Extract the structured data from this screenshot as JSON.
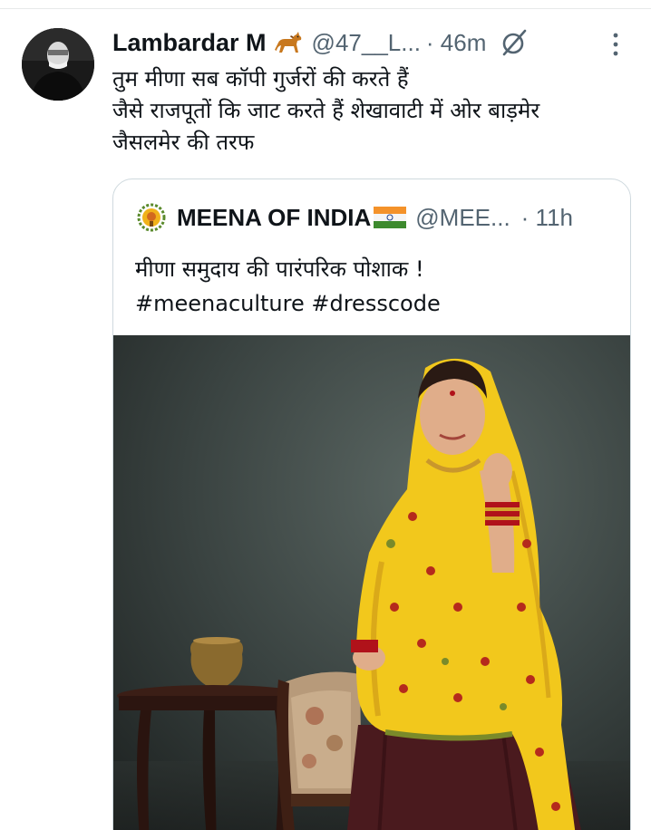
{
  "tweet": {
    "author": {
      "display_name": "Lambardar M",
      "name_emoji": "horse-icon",
      "handle": "@47__L...",
      "separator_time": "· 46m"
    },
    "text_lines": [
      "तुम  मीणा सब कॉपी गुर्जरों की करते हैं",
      "जैसे राजपूतों कि जाट करते हैं शेखावाटी में ओर बाड़मेर",
      "जैसलमेर की तरफ"
    ],
    "quoted": {
      "display_name": "MEENA OF INDIA",
      "name_emoji": "india-flag-icon",
      "handle": "@MEE...",
      "separator_time": "· 11h",
      "text_lines": [
        "मीणा समुदाय की पारंपरिक पोशाक !",
        "#meenaculture #dresscode"
      ]
    }
  },
  "colors": {
    "text_primary": "#0f1419",
    "text_secondary": "#536471",
    "border": "#cfd9de",
    "dupatta_yellow": "#f2c81c",
    "skirt_maroon": "#4a1a1e"
  }
}
